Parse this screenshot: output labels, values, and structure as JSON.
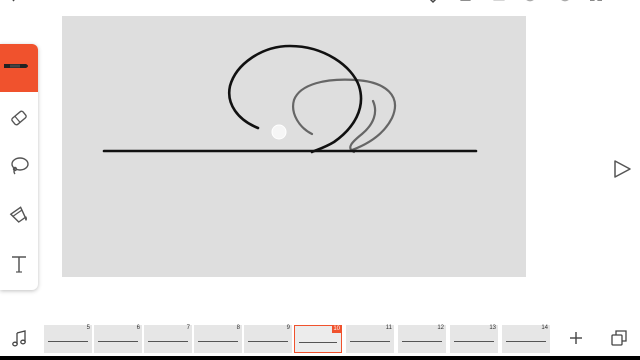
{
  "toolbar": {
    "icons": [
      "back-icon",
      "check-icon",
      "layers-icon",
      "square-icon",
      "undo-icon",
      "redo-icon",
      "expand-icon",
      "menu-icon"
    ]
  },
  "tools": [
    {
      "name": "brush-tool",
      "icon": "brush-icon",
      "active": true
    },
    {
      "name": "eraser-tool",
      "icon": "eraser-icon",
      "active": false
    },
    {
      "name": "lasso-tool",
      "icon": "lasso-icon",
      "active": false
    },
    {
      "name": "fill-tool",
      "icon": "fill-bucket-icon",
      "active": false
    },
    {
      "name": "text-tool",
      "icon": "text-icon",
      "active": false
    }
  ],
  "colors": {
    "accent": "#f0522d",
    "canvas": "#dedede",
    "stroke_current": "#000000",
    "stroke_onion": "#666666"
  },
  "frames": [
    {
      "number": "5",
      "current": false
    },
    {
      "number": "6",
      "current": false
    },
    {
      "number": "7",
      "current": false
    },
    {
      "number": "8",
      "current": false
    },
    {
      "number": "9",
      "current": false
    },
    {
      "number": "10",
      "current": true
    },
    {
      "number": "11",
      "current": false
    },
    {
      "number": "12",
      "current": false
    },
    {
      "number": "13",
      "current": false
    },
    {
      "number": "14",
      "current": false
    }
  ]
}
